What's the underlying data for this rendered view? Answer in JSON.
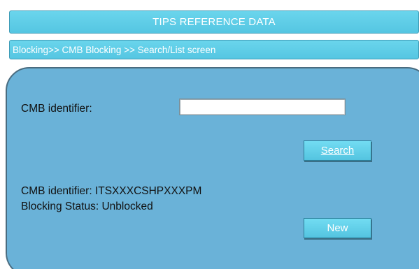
{
  "header": {
    "title": "TIPS REFERENCE DATA"
  },
  "breadcrumb": {
    "text": "Blocking>> CMB Blocking >> Search/List screen"
  },
  "form": {
    "cmb_identifier_label": "CMB identifier:",
    "cmb_identifier_value": "",
    "search_label": "Search"
  },
  "result": {
    "cmb_identifier_text": "CMB identifier: ITSXXXCSHPXXXPM",
    "blocking_status_text": "Blocking Status: Unblocked"
  },
  "actions": {
    "new_label": "New"
  },
  "colors": {
    "bar_fill": "#55c6e2",
    "panel_fill": "#6ab2d8",
    "panel_border": "#4a6c80"
  }
}
